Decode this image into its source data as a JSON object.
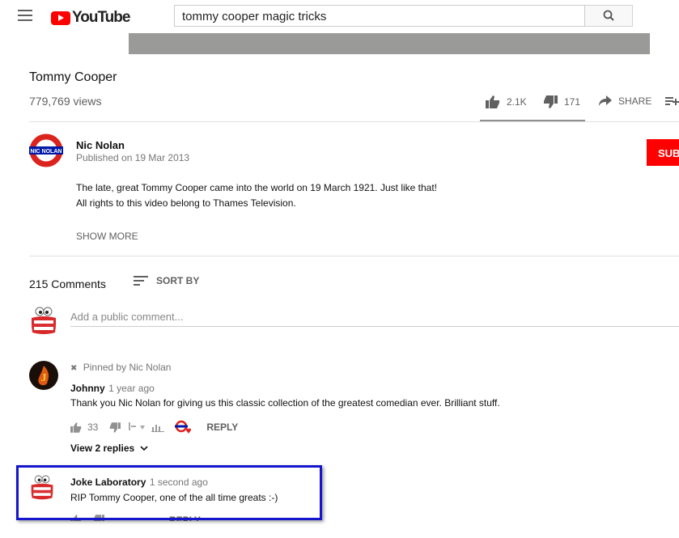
{
  "header": {
    "logo_text": "YouTube",
    "search_value": "tommy cooper magic tricks"
  },
  "video": {
    "title": "Tommy Cooper",
    "views": "779,769 views",
    "likes": "2.1K",
    "dislikes": "171",
    "share_label": "SHARE"
  },
  "channel": {
    "name": "Nic Nolan",
    "logo_text": "NIC NOLAN",
    "published": "Published on 19 Mar 2013",
    "subscribe_label": "SUBS",
    "description_lines": [
      "The late, great Tommy Cooper came into the world on 19 March 1921. Just like that!",
      "All rights to this video belong to Thames Television."
    ],
    "show_more": "SHOW MORE"
  },
  "comments": {
    "count": "215 Comments",
    "sort_label": "SORT BY",
    "add_placeholder": "Add a public comment...",
    "pinned": {
      "pinned_label": "Pinned by Nic Nolan",
      "author": "Johnny",
      "time": "1 year ago",
      "text": "Thank you Nic Nolan for giving us this classic collection of the greatest comedian ever.  Brilliant stuff.",
      "likes": "33",
      "reply_label": "REPLY",
      "view_replies": "View 2 replies"
    },
    "new_comment": {
      "author": "Joke Laboratory",
      "time": "1 second ago",
      "text": "RIP Tommy Cooper, one of the all time greats :-)",
      "reply_label": "REPLY"
    }
  },
  "colors": {
    "brand_red": "#ff0000",
    "highlight_blue": "#1515cc"
  }
}
